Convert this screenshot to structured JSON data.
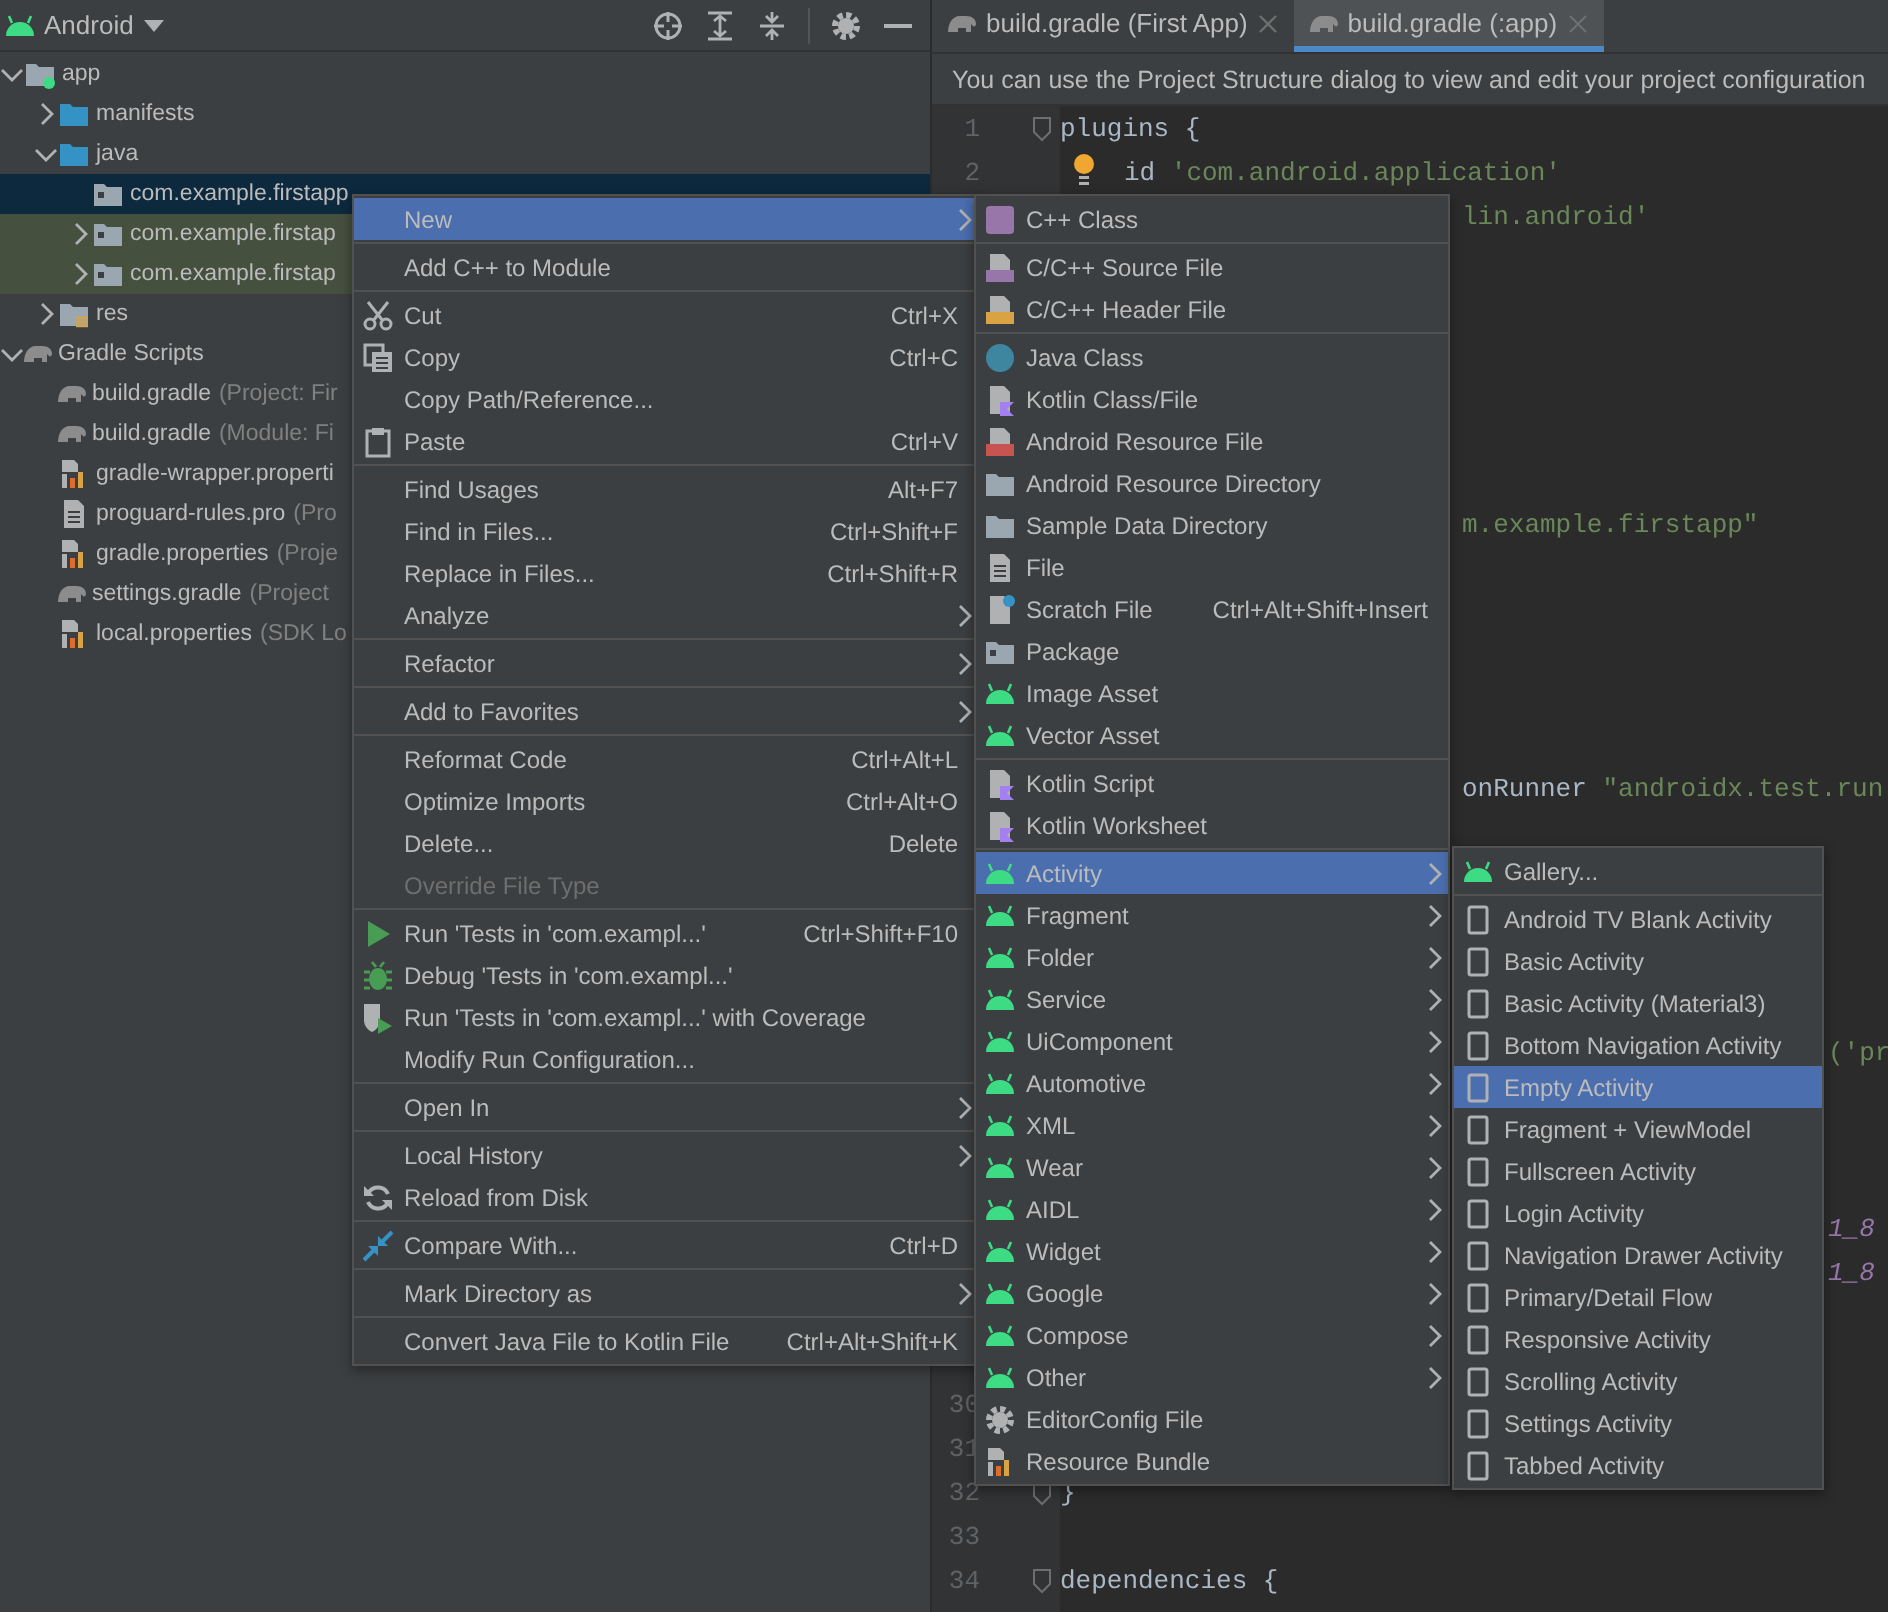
{
  "project_panel": {
    "view_selector": "Android",
    "tree": [
      {
        "label": "app",
        "kind": "module",
        "expanded": true,
        "selected": false,
        "highlighted": false,
        "children": [
          {
            "label": "manifests",
            "kind": "bluefolder",
            "expanded": false,
            "selected": false,
            "highlighted": false
          },
          {
            "label": "java",
            "kind": "bluefolder",
            "expanded": true,
            "selected": false,
            "highlighted": false,
            "children": [
              {
                "label": "com.example.firstapp",
                "kind": "package",
                "selected": true,
                "highlighted": false
              },
              {
                "label": "com.example.firstap",
                "kind": "package",
                "expanded": false,
                "selected": false,
                "highlighted": true
              },
              {
                "label": "com.example.firstap",
                "kind": "package",
                "expanded": false,
                "selected": false,
                "highlighted": true
              }
            ]
          },
          {
            "label": "res",
            "kind": "resfolder",
            "expanded": false,
            "selected": false,
            "highlighted": false
          }
        ]
      },
      {
        "label": "Gradle Scripts",
        "kind": "gradle",
        "expanded": true,
        "selected": false,
        "highlighted": false,
        "children": [
          {
            "label": "build.gradle",
            "detail": "(Project: Fir",
            "kind": "gradle",
            "selected": false,
            "highlighted": false
          },
          {
            "label": "build.gradle",
            "detail": "(Module: Fi",
            "kind": "gradle",
            "selected": false,
            "highlighted": false
          },
          {
            "label": "gradle-wrapper.properti",
            "kind": "props",
            "selected": false,
            "highlighted": false
          },
          {
            "label": "proguard-rules.pro",
            "detail": "(Pro",
            "kind": "doc",
            "selected": false,
            "highlighted": false
          },
          {
            "label": "gradle.properties",
            "detail": "(Proje",
            "kind": "props",
            "selected": false,
            "highlighted": false
          },
          {
            "label": "settings.gradle",
            "detail": "(Project",
            "kind": "gradle",
            "selected": false,
            "highlighted": false
          },
          {
            "label": "local.properties",
            "detail": "(SDK Lo",
            "kind": "props",
            "selected": false,
            "highlighted": false
          }
        ]
      }
    ]
  },
  "editor": {
    "tabs": [
      {
        "label": "build.gradle (First App)",
        "selected": false
      },
      {
        "label": "build.gradle (:app)",
        "selected": true
      }
    ],
    "banner": "You can use the Project Structure dialog to view and edit your project configuration",
    "lines": [
      {
        "number": "1",
        "fold": true,
        "bulb": false,
        "kind": "top",
        "tokens": [
          {
            "text": "plugins",
            "kind": "plain"
          },
          {
            "text": "{",
            "kind": "plain"
          }
        ]
      },
      {
        "number": "2",
        "fold": false,
        "bulb": true,
        "kind": "nested",
        "tokens": [
          {
            "text": "id",
            "kind": "plain"
          },
          {
            "text": "'com.android.application'",
            "kind": "string"
          }
        ]
      },
      {
        "number": "30",
        "fold": false,
        "bulb": false
      },
      {
        "number": "31",
        "fold": false,
        "bulb": false
      },
      {
        "number": "32",
        "fold": true,
        "bulb": false,
        "kind": "top",
        "tokens": [
          {
            "text": "}",
            "kind": "plain"
          }
        ]
      },
      {
        "number": "33",
        "fold": false,
        "bulb": false
      },
      {
        "number": "34",
        "fold": true,
        "bulb": false,
        "kind": "top",
        "tokens": [
          {
            "text": "dependencies",
            "kind": "plain"
          },
          {
            "text": "{",
            "kind": "plain"
          }
        ]
      }
    ],
    "fragments": [
      {
        "kind": "mid",
        "tokens": [
          {
            "text": "lin.android'",
            "kind": "string"
          }
        ]
      },
      {
        "kind": "mid",
        "tokens": [
          {
            "text": "m.example.firstapp\"",
            "kind": "string"
          }
        ]
      },
      {
        "kind": "mid",
        "tokens": [
          {
            "text": "onRunner",
            "kind": "plain"
          },
          {
            "text": "\"androidx.test.run",
            "kind": "string"
          }
        ]
      },
      {
        "kind": "far",
        "tokens": [
          {
            "text": "('pr",
            "kind": "string"
          }
        ]
      },
      {
        "kind": "far",
        "tokens": [
          {
            "text": "1_8",
            "kind": "number"
          }
        ]
      },
      {
        "kind": "far",
        "tokens": [
          {
            "text": "1_8",
            "kind": "number"
          }
        ]
      }
    ]
  },
  "context_menu": {
    "groups": [
      [
        {
          "label": "New",
          "kind": "plain",
          "submenu": true,
          "selected": true,
          "disabled": false
        }
      ],
      [
        {
          "label": "Add C++ to Module",
          "kind": "plain",
          "submenu": false,
          "selected": false,
          "disabled": false
        }
      ],
      [
        {
          "label": "Cut",
          "shortcut": "Ctrl+X",
          "kind": "cut",
          "submenu": false,
          "selected": false,
          "disabled": false
        },
        {
          "label": "Copy",
          "shortcut": "Ctrl+C",
          "kind": "copy",
          "submenu": false,
          "selected": false,
          "disabled": false
        },
        {
          "label": "Copy Path/Reference...",
          "kind": "plain",
          "submenu": false,
          "selected": false,
          "disabled": false
        },
        {
          "label": "Paste",
          "shortcut": "Ctrl+V",
          "kind": "paste",
          "submenu": false,
          "selected": false,
          "disabled": false
        }
      ],
      [
        {
          "label": "Find Usages",
          "shortcut": "Alt+F7",
          "kind": "plain",
          "submenu": false,
          "selected": false,
          "disabled": false
        },
        {
          "label": "Find in Files...",
          "shortcut": "Ctrl+Shift+F",
          "kind": "plain",
          "submenu": false,
          "selected": false,
          "disabled": false
        },
        {
          "label": "Replace in Files...",
          "shortcut": "Ctrl+Shift+R",
          "kind": "plain",
          "submenu": false,
          "selected": false,
          "disabled": false
        },
        {
          "label": "Analyze",
          "kind": "plain",
          "submenu": true,
          "selected": false,
          "disabled": false
        }
      ],
      [
        {
          "label": "Refactor",
          "kind": "plain",
          "submenu": true,
          "selected": false,
          "disabled": false
        }
      ],
      [
        {
          "label": "Add to Favorites",
          "kind": "plain",
          "submenu": true,
          "selected": false,
          "disabled": false
        }
      ],
      [
        {
          "label": "Reformat Code",
          "shortcut": "Ctrl+Alt+L",
          "kind": "plain",
          "submenu": false,
          "selected": false,
          "disabled": false
        },
        {
          "label": "Optimize Imports",
          "shortcut": "Ctrl+Alt+O",
          "kind": "plain",
          "submenu": false,
          "selected": false,
          "disabled": false
        },
        {
          "label": "Delete...",
          "shortcut": "Delete",
          "kind": "plain",
          "submenu": false,
          "selected": false,
          "disabled": false
        },
        {
          "label": "Override File Type",
          "kind": "plain",
          "submenu": false,
          "selected": false,
          "disabled": true
        }
      ],
      [
        {
          "label": "Run 'Tests in 'com.exampl...'",
          "shortcut": "Ctrl+Shift+F10",
          "kind": "run",
          "submenu": false,
          "selected": false,
          "disabled": false
        },
        {
          "label": "Debug 'Tests in 'com.exampl...'",
          "kind": "debug",
          "submenu": false,
          "selected": false,
          "disabled": false
        },
        {
          "label": "Run 'Tests in 'com.exampl...' with Coverage",
          "kind": "coverage",
          "submenu": false,
          "selected": false,
          "disabled": false
        },
        {
          "label": "Modify Run Configuration...",
          "kind": "plain",
          "submenu": false,
          "selected": false,
          "disabled": false
        }
      ],
      [
        {
          "label": "Open In",
          "kind": "plain",
          "submenu": true,
          "selected": false,
          "disabled": false
        }
      ],
      [
        {
          "label": "Local History",
          "kind": "plain",
          "submenu": true,
          "selected": false,
          "disabled": false
        },
        {
          "label": "Reload from Disk",
          "kind": "reload",
          "submenu": false,
          "selected": false,
          "disabled": false
        }
      ],
      [
        {
          "label": "Compare With...",
          "shortcut": "Ctrl+D",
          "kind": "compare",
          "submenu": false,
          "selected": false,
          "disabled": false
        }
      ],
      [
        {
          "label": "Mark Directory as",
          "kind": "plain",
          "submenu": true,
          "selected": false,
          "disabled": false
        }
      ],
      [
        {
          "label": "Convert Java File to Kotlin File",
          "shortcut": "Ctrl+Alt+Shift+K",
          "kind": "plain",
          "submenu": false,
          "selected": false,
          "disabled": false
        }
      ]
    ]
  },
  "new_submenu": {
    "groups": [
      [
        {
          "label": "C++ Class",
          "kind": "cppclass",
          "submenu": false,
          "selected": false
        }
      ],
      [
        {
          "label": "C/C++ Source File",
          "kind": "cppsource",
          "submenu": false,
          "selected": false
        },
        {
          "label": "C/C++ Header File",
          "kind": "cppheader",
          "submenu": false,
          "selected": false
        }
      ],
      [
        {
          "label": "Java Class",
          "kind": "javaclass",
          "submenu": false,
          "selected": false
        },
        {
          "label": "Kotlin Class/File",
          "kind": "kotlinfile",
          "submenu": false,
          "selected": false
        },
        {
          "label": "Android Resource File",
          "kind": "resfile",
          "submenu": false,
          "selected": false
        },
        {
          "label": "Android Resource Directory",
          "kind": "folder",
          "submenu": false,
          "selected": false
        },
        {
          "label": "Sample Data Directory",
          "kind": "folder",
          "submenu": false,
          "selected": false
        },
        {
          "label": "File",
          "kind": "file",
          "submenu": false,
          "selected": false
        },
        {
          "label": "Scratch File",
          "shortcut": "Ctrl+Alt+Shift+Insert",
          "kind": "scratch",
          "submenu": false,
          "selected": false
        },
        {
          "label": "Package",
          "kind": "package",
          "submenu": false,
          "selected": false
        },
        {
          "label": "Image Asset",
          "kind": "android",
          "submenu": false,
          "selected": false
        },
        {
          "label": "Vector Asset",
          "kind": "android",
          "submenu": false,
          "selected": false
        }
      ],
      [
        {
          "label": "Kotlin Script",
          "kind": "kotlinscript",
          "submenu": false,
          "selected": false
        },
        {
          "label": "Kotlin Worksheet",
          "kind": "kotlinscript",
          "submenu": false,
          "selected": false
        }
      ],
      [
        {
          "label": "Activity",
          "kind": "android",
          "submenu": true,
          "selected": true
        },
        {
          "label": "Fragment",
          "kind": "android",
          "submenu": true,
          "selected": false
        },
        {
          "label": "Folder",
          "kind": "android",
          "submenu": true,
          "selected": false
        },
        {
          "label": "Service",
          "kind": "android",
          "submenu": true,
          "selected": false
        },
        {
          "label": "UiComponent",
          "kind": "android",
          "submenu": true,
          "selected": false
        },
        {
          "label": "Automotive",
          "kind": "android",
          "submenu": true,
          "selected": false
        },
        {
          "label": "XML",
          "kind": "android",
          "submenu": true,
          "selected": false
        },
        {
          "label": "Wear",
          "kind": "android",
          "submenu": true,
          "selected": false
        },
        {
          "label": "AIDL",
          "kind": "android",
          "submenu": true,
          "selected": false
        },
        {
          "label": "Widget",
          "kind": "android",
          "submenu": true,
          "selected": false
        },
        {
          "label": "Google",
          "kind": "android",
          "submenu": true,
          "selected": false
        },
        {
          "label": "Compose",
          "kind": "android",
          "submenu": true,
          "selected": false
        },
        {
          "label": "Other",
          "kind": "android",
          "submenu": true,
          "selected": false
        },
        {
          "label": "EditorConfig File",
          "kind": "config",
          "submenu": false,
          "selected": false
        },
        {
          "label": "Resource Bundle",
          "kind": "bundle",
          "submenu": false,
          "selected": false
        }
      ]
    ]
  },
  "activity_submenu": {
    "groups": [
      [
        {
          "label": "Gallery...",
          "kind": "android",
          "selected": false
        }
      ],
      [
        {
          "label": "Android TV Blank Activity",
          "kind": "screen",
          "selected": false
        },
        {
          "label": "Basic Activity",
          "kind": "screen",
          "selected": false
        },
        {
          "label": "Basic Activity (Material3)",
          "kind": "screen",
          "selected": false
        },
        {
          "label": "Bottom Navigation Activity",
          "kind": "screen",
          "selected": false
        },
        {
          "label": "Empty Activity",
          "kind": "screen",
          "selected": true
        },
        {
          "label": "Fragment + ViewModel",
          "kind": "screen",
          "selected": false
        },
        {
          "label": "Fullscreen Activity",
          "kind": "screen",
          "selected": false
        },
        {
          "label": "Login Activity",
          "kind": "screen",
          "selected": false
        },
        {
          "label": "Navigation Drawer Activity",
          "kind": "screen",
          "selected": false
        },
        {
          "label": "Primary/Detail Flow",
          "kind": "screen",
          "selected": false
        },
        {
          "label": "Responsive Activity",
          "kind": "screen",
          "selected": false
        },
        {
          "label": "Scrolling Activity",
          "kind": "screen",
          "selected": false
        },
        {
          "label": "Settings Activity",
          "kind": "screen",
          "selected": false
        },
        {
          "label": "Tabbed Activity",
          "kind": "screen",
          "selected": false
        }
      ]
    ]
  }
}
